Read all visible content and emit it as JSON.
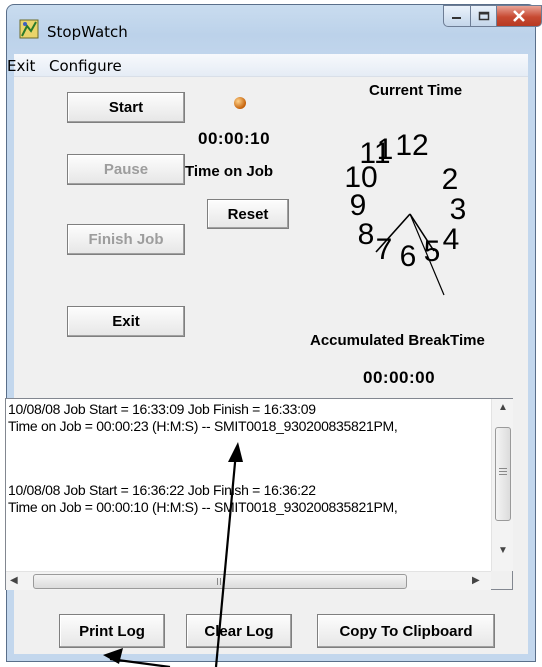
{
  "window": {
    "title": "StopWatch"
  },
  "menu": [
    "Exit",
    "Configure"
  ],
  "buttons": {
    "start": "Start",
    "pause": "Pause",
    "finish_job": "Finish Job",
    "exit": "Exit",
    "reset": "Reset",
    "print_log": "Print Log",
    "clear_log": "Clear Log",
    "copy_clipboard": "Copy To Clipboard"
  },
  "timer": {
    "value": "00:00:10",
    "label": "Time on Job",
    "status_color": "#e07a10"
  },
  "clock": {
    "title": "Current Time",
    "numerals": [
      "12",
      "1",
      "2",
      "3",
      "4",
      "5",
      "6",
      "7",
      "8",
      "9",
      "10",
      "11"
    ]
  },
  "break": {
    "label": "Accumulated BreakTime",
    "value": "00:00:00"
  },
  "log": {
    "lines": [
      "10/08/08 Job Start = 16:33:09 Job Finish = 16:33:09",
      "Time on Job = 00:00:23 (H:M:S)  --  SMIT0018_930200835821PM,",
      "",
      "10/08/08 Job Start = 16:36:22 Job Finish = 16:36:22",
      "Time on Job = 00:00:10 (H:M:S)  --  SMIT0018_930200835821PM,"
    ]
  }
}
